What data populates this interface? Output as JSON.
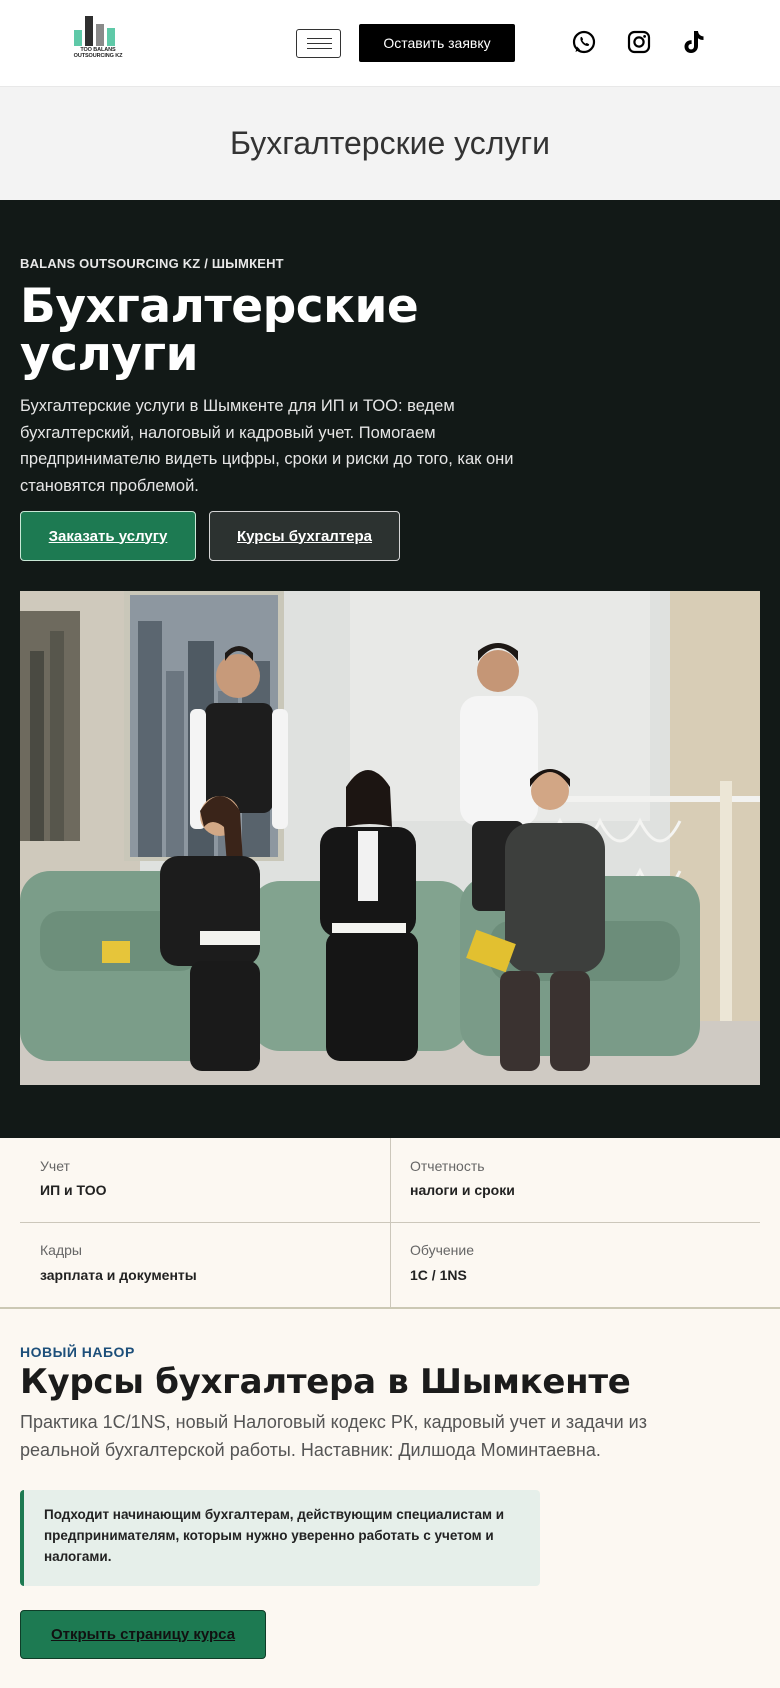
{
  "header": {
    "logo_text": "ТОО BALANS OUTSOURCING KZ",
    "cta_label": "Оставить заявку",
    "menu_icon": "hamburger-icon",
    "social": [
      "whatsapp-icon",
      "instagram-icon",
      "tiktok-icon"
    ]
  },
  "title_band": {
    "title": "Бухгалтерские услуги"
  },
  "hero": {
    "eyebrow": "BALANS OUTSOURCING KZ / ШЫМКЕНТ",
    "title": "Бухгалтерские услуги",
    "description": "Бухгалтерские услуги в Шымкенте для ИП и ТОО: ведем бухгалтерский, налоговый и кадровый учет. Помогаем предпринимателю видеть цифры, сроки и риски до того, как они становятся проблемой.",
    "primary_button": "Заказать услугу",
    "secondary_button": "Курсы бухгалтера"
  },
  "stats": [
    {
      "label": "Учет",
      "value": "ИП и ТОО"
    },
    {
      "label": "Отчетность",
      "value": "налоги и сроки"
    },
    {
      "label": "Кадры",
      "value": "зарплата и документы"
    },
    {
      "label": "Обучение",
      "value": "1С / 1NS"
    }
  ],
  "course": {
    "eyebrow": "НОВЫЙ НАБОР",
    "title": "Курсы бухгалтера в Шымкенте",
    "description": "Практика 1С/1NS, новый Налоговый кодекс РК, кадровый учет и задачи из реальной бухгалтерской работы. Наставник: Дилшода Моминтаевна.",
    "callout": "Подходит начинающим бухгалтерам, действующим специалистам и предпринимателям, которым нужно уверенно работать с учетом и налогами.",
    "button": "Открыть страницу курса"
  },
  "colors": {
    "brand_green": "#1d7a52",
    "hero_bg": "#121917",
    "accent_blue": "#1d4f7a",
    "page_bg": "#fcf8f2"
  }
}
